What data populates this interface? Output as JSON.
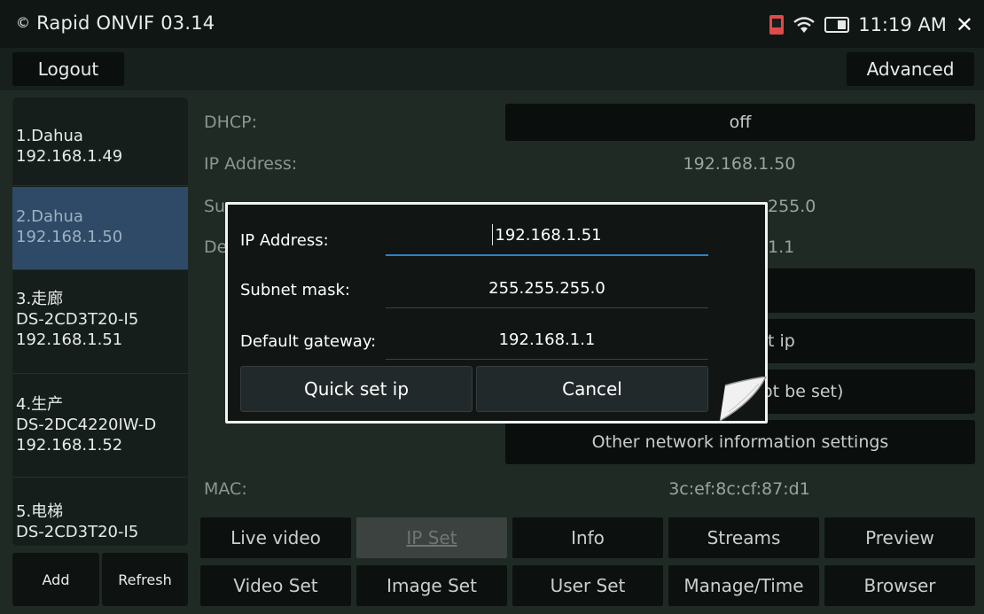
{
  "statusbar": {
    "app_title": "Rapid ONVIF 03.14",
    "time": "11:19 AM",
    "close_glyph": "✕",
    "icons": [
      "sd-card-icon",
      "wifi-icon",
      "battery-icon",
      "close-icon"
    ]
  },
  "toolbar": {
    "logout_label": "Logout",
    "advanced_label": "Advanced"
  },
  "devices": [
    {
      "lines": [
        "1.Dahua",
        "192.168.1.49"
      ],
      "selected": false
    },
    {
      "lines": [
        "2.Dahua",
        "192.168.1.50"
      ],
      "selected": true
    },
    {
      "lines": [
        "3.走廊",
        "DS-2CD3T20-I5",
        "192.168.1.51"
      ],
      "selected": false
    },
    {
      "lines": [
        "4.生产",
        "DS-2DC4220IW-D",
        "192.168.1.52"
      ],
      "selected": false
    },
    {
      "lines": [
        "5.电梯",
        "DS-2CD3T20-I5"
      ],
      "selected": false
    }
  ],
  "sidebar_buttons": {
    "add_label": "Add",
    "refresh_label": "Refresh"
  },
  "form": {
    "dhcp_label": "DHCP:",
    "dhcp_value": "off",
    "ip_label": "IP Address:",
    "ip_value": "192.168.1.50",
    "subnet_label_partial": "Su",
    "subnet_value_partial": "255.0",
    "gateway_label_partial": "De",
    "gateway_value_partial": "1.1",
    "quick_set_partial": "t ip",
    "note_partial": "not be set)",
    "other_settings_label": "Other network information settings",
    "mac_label": "MAC:",
    "mac_value": "3c:ef:8c:cf:87:d1"
  },
  "tabs": [
    {
      "label": "Live video",
      "active": false
    },
    {
      "label": "IP Set",
      "active": true
    },
    {
      "label": "Info",
      "active": false
    },
    {
      "label": "Streams",
      "active": false
    },
    {
      "label": "Preview",
      "active": false
    },
    {
      "label": "Video Set",
      "active": false
    },
    {
      "label": "Image Set",
      "active": false
    },
    {
      "label": "User Set",
      "active": false
    },
    {
      "label": "Manage/Time",
      "active": false
    },
    {
      "label": "Browser",
      "active": false
    }
  ],
  "dialog": {
    "ip_label": "IP Address:",
    "ip_value": "192.168.1.51",
    "subnet_label": "Subnet mask:",
    "subnet_value": "255.255.255.0",
    "gateway_label": "Default gateway:",
    "gateway_value": "192.168.1.1",
    "quick_set_label": "Quick set ip",
    "cancel_label": "Cancel"
  },
  "colors": {
    "selected_row": "#2e4a66",
    "focus_underline": "#2f80c8",
    "sd_card": "#e04a4a"
  }
}
